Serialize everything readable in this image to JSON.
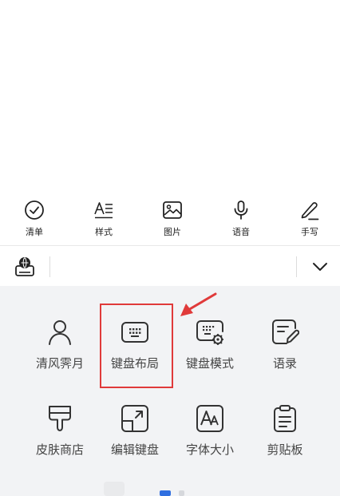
{
  "toolbar": {
    "items": [
      {
        "label": "清单",
        "icon": "check-circle-icon"
      },
      {
        "label": "样式",
        "icon": "text-style-icon"
      },
      {
        "label": "图片",
        "icon": "image-icon"
      },
      {
        "label": "语音",
        "icon": "microphone-icon"
      },
      {
        "label": "手写",
        "icon": "pen-icon"
      }
    ]
  },
  "candidate_bar": {
    "left_icon": "keyboard-globe-icon",
    "right_icon": "chevron-down-icon"
  },
  "panel": {
    "items": [
      {
        "label": "清风霁月",
        "icon": "person-icon"
      },
      {
        "label": "键盘布局",
        "icon": "keyboard-layout-icon"
      },
      {
        "label": "键盘模式",
        "icon": "keyboard-settings-icon"
      },
      {
        "label": "语录",
        "icon": "edit-note-icon"
      },
      {
        "label": "皮肤商店",
        "icon": "brush-icon"
      },
      {
        "label": "编辑键盘",
        "icon": "edit-keyboard-icon"
      },
      {
        "label": "字体大小",
        "icon": "font-size-icon"
      },
      {
        "label": "剪贴板",
        "icon": "clipboard-icon"
      }
    ],
    "highlighted_item": "键盘布局"
  },
  "colors": {
    "panel_bg": "#f2f3f5",
    "highlight": "#e03a3a",
    "accent": "#2f6fe0",
    "icon": "#333333"
  }
}
